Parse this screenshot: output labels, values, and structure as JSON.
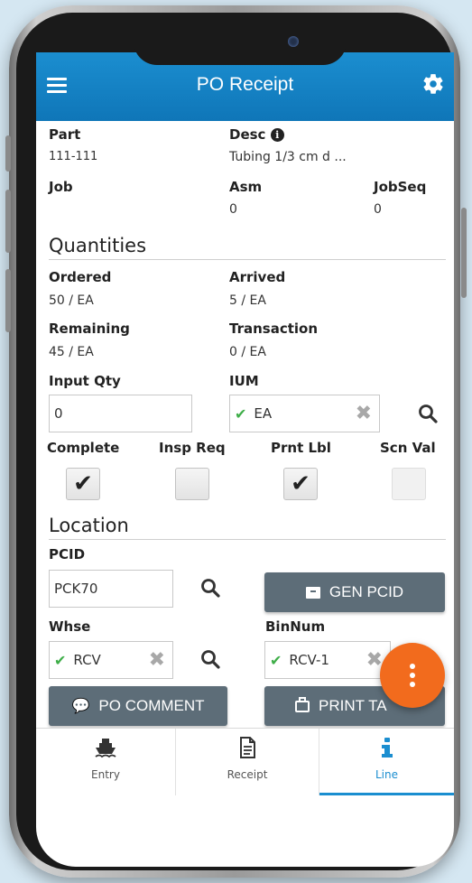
{
  "header": {
    "title": "PO Receipt"
  },
  "fields": {
    "part_label": "Part",
    "part_value": "111-111",
    "desc_label": "Desc",
    "desc_value": "Tubing 1/3 cm d ...",
    "job_label": "Job",
    "asm_label": "Asm",
    "asm_value": "0",
    "jobseq_label": "JobSeq",
    "jobseq_value": "0"
  },
  "quantities": {
    "title": "Quantities",
    "ordered_label": "Ordered",
    "ordered_value": "50 / EA",
    "arrived_label": "Arrived",
    "arrived_value": "5 / EA",
    "remaining_label": "Remaining",
    "remaining_value": "45 / EA",
    "transaction_label": "Transaction",
    "transaction_value": "0 / EA",
    "input_qty_label": "Input Qty",
    "input_qty_value": "0",
    "ium_label": "IUM",
    "ium_value": "EA",
    "complete_label": "Complete",
    "complete_checked": true,
    "insp_req_label": "Insp Req",
    "insp_req_checked": false,
    "prnt_lbl_label": "Prnt Lbl",
    "prnt_lbl_checked": true,
    "scn_val_label": "Scn Val",
    "scn_val_checked": false
  },
  "location": {
    "title": "Location",
    "pcid_label": "PCID",
    "pcid_value": "PCK70",
    "gen_pcid_label": "GEN PCID",
    "whse_label": "Whse",
    "whse_value": "RCV",
    "binnum_label": "BinNum",
    "binnum_value": "RCV-1",
    "po_comment_label": "PO COMMENT",
    "print_tag_label": "PRINT TA"
  },
  "tabs": [
    {
      "label": "Entry",
      "icon": "ship-icon",
      "active": false
    },
    {
      "label": "Receipt",
      "icon": "document-icon",
      "active": false
    },
    {
      "label": "Line",
      "icon": "info-icon",
      "active": true
    }
  ],
  "colors": {
    "header": "#1b8ed0",
    "button": "#5d6d78",
    "fab": "#f26b1d",
    "check": "#3fae49"
  }
}
